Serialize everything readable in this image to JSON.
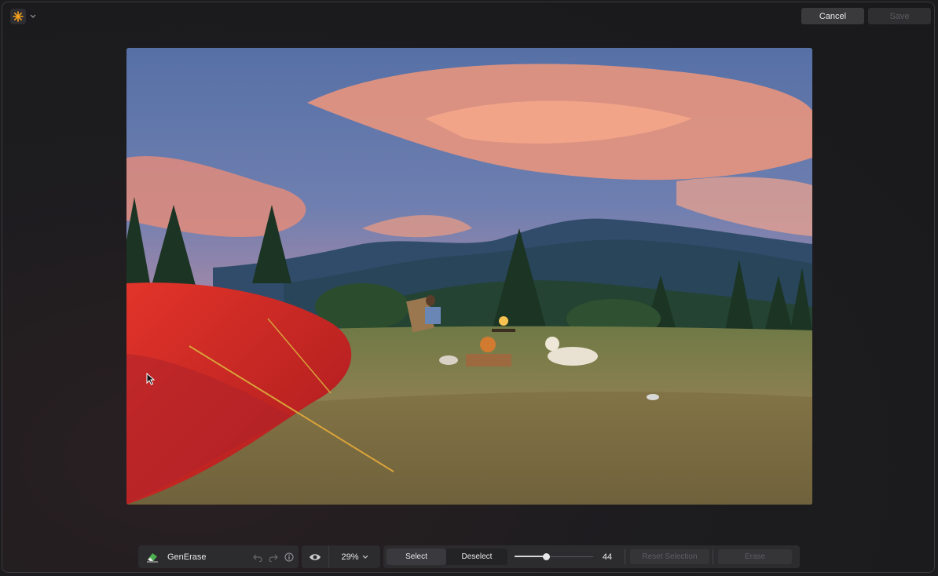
{
  "topbar": {
    "app_icon": "asterisk-sun-icon",
    "cancel_label": "Cancel",
    "save_label": "Save"
  },
  "photo": {
    "description_icon": "image"
  },
  "toolbar": {
    "tool_icon": "eraser-icon",
    "tool_label": "GenErase",
    "undo_icon": "undo-icon",
    "redo_icon": "redo-icon",
    "info_icon": "info-icon",
    "preview_icon": "eye-icon",
    "zoom_value": "29%",
    "select_label": "Select",
    "deselect_label": "Deselect",
    "brush_size": "44",
    "brush_size_fraction": 0.4,
    "reset_selection_label": "Reset Selection",
    "erase_label": "Erase"
  },
  "colors": {
    "accent": "#f7a21b",
    "save_disabled_text": "#5b5a5e"
  }
}
